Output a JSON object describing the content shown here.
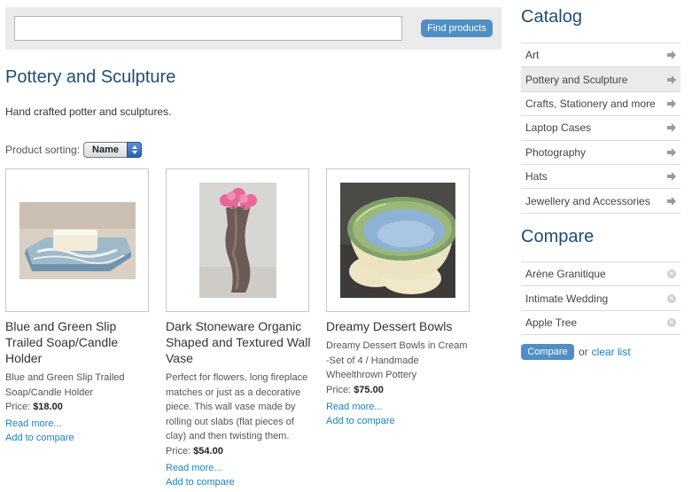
{
  "search": {
    "value": "",
    "placeholder": "",
    "button_label": "Find products"
  },
  "main": {
    "title": "Pottery and Sculpture",
    "description": "Hand crafted potter and sculptures.",
    "sorting": {
      "label": "Product sorting:",
      "selected": "Name"
    }
  },
  "products": [
    {
      "name": "Blue and Green Slip Trailed Soap/Candle Holder",
      "description": "Blue and Green Slip Trailed Soap/Candle Holder",
      "price_label": "Price:",
      "price": "$18.00",
      "read_more": "Read more...",
      "add_compare": "Add to compare",
      "image": "soap-dish-image"
    },
    {
      "name": "Dark Stoneware Organic Shaped and Textured Wall Vase",
      "description": "Perfect for flowers, long fireplace matches or just as a decorative piece. This wall vase made by rolling out slabs (flat pieces of clay) and then twisting them.",
      "price_label": "Price:",
      "price": "$54.00",
      "read_more": "Read more...",
      "add_compare": "Add to compare",
      "image": "wall-vase-image"
    },
    {
      "name": "Dreamy Dessert Bowls",
      "description": "Dreamy Dessert Bowls in Cream -Set of 4 / Handmade Wheelthrown Pottery",
      "price_label": "Price:",
      "price": "$75.00",
      "read_more": "Read more...",
      "add_compare": "Add to compare",
      "image": "dessert-bowls-image"
    }
  ],
  "sidebar": {
    "catalog_title": "Catalog",
    "catalog_items": [
      {
        "label": "Art",
        "active": false
      },
      {
        "label": "Pottery and Sculpture",
        "active": true
      },
      {
        "label": "Crafts, Stationery and more",
        "active": false
      },
      {
        "label": "Laptop Cases",
        "active": false
      },
      {
        "label": "Photography",
        "active": false
      },
      {
        "label": "Hats",
        "active": false
      },
      {
        "label": "Jewellery and Accessories",
        "active": false
      }
    ],
    "compare_title": "Compare",
    "compare_items": [
      {
        "label": "Arène Granitique"
      },
      {
        "label": "Intimate Wedding"
      },
      {
        "label": "Apple Tree"
      }
    ],
    "compare_button": "Compare",
    "or_text": "or",
    "clear_list": "clear list"
  },
  "colors": {
    "accent": "#4f8fc6",
    "heading": "#1f4d75",
    "link": "#1a82c3",
    "panel": "#ebebeb"
  },
  "icons": {
    "catalog_item": "arrow-right-icon",
    "compare_item": "remove-icon"
  }
}
